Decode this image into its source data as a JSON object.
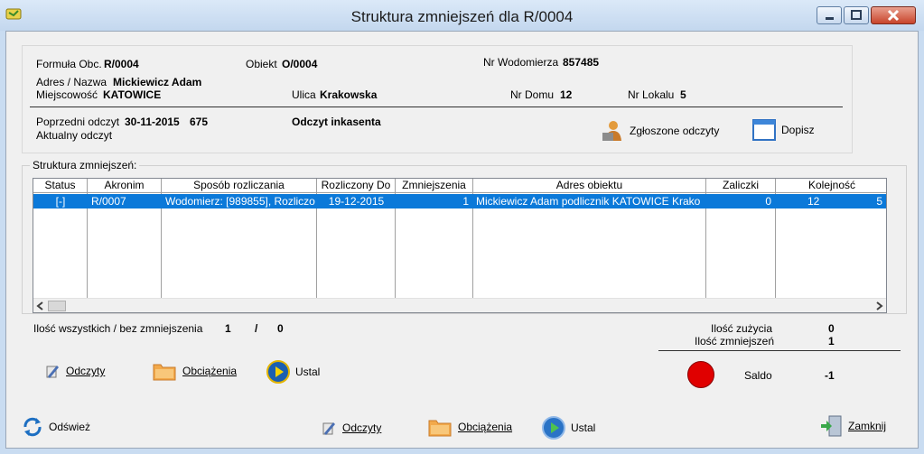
{
  "window": {
    "title": "Struktura zmniejszeń dla R/0004"
  },
  "info": {
    "formula_label": "Formuła Obc.",
    "formula_value": "R/0004",
    "obiekt_label": "Obiekt",
    "obiekt_value": "O/0004",
    "wodomierz_label": "Nr Wodomierza",
    "wodomierz_value": "857485",
    "adres_label": "Adres / Nazwa",
    "adres_value": "Mickiewicz Adam",
    "miejscowosc_label": "Miejscowość",
    "miejscowosc_value": "KATOWICE",
    "ulica_label": "Ulica",
    "ulica_value": "Krakowska",
    "domu_label": "Nr Domu",
    "domu_value": "12",
    "lokalu_label": "Nr Lokalu",
    "lokalu_value": "5",
    "poprzedni_label": "Poprzedni odczyt",
    "poprzedni_date": "30-11-2015",
    "poprzedni_value": "675",
    "aktualny_label": "Aktualny odczyt",
    "inkasenta": "Odczyt inkasenta",
    "zgloszone_label": "Zgłoszone odczyty",
    "dopisz_label": "Dopisz"
  },
  "group": {
    "title": "Struktura zmniejszeń:"
  },
  "table": {
    "headers": [
      "Status",
      "Akronim",
      "Sposób rozliczania",
      "Rozliczony Do",
      "Zmniejszenia",
      "Adres obiektu",
      "Zaliczki",
      "Kolejność"
    ],
    "rows": [
      [
        "[-]",
        "R/0007",
        "Wodomierz: [989855], Rozliczo",
        "19-12-2015",
        "1",
        "Mickiewicz Adam podlicznik KATOWICE Krako",
        "0",
        "12",
        "5"
      ]
    ]
  },
  "summary": {
    "ilosc_label": "Ilość wszystkich / bez zmniejszenia",
    "ilosc_all": "1",
    "sep": "/",
    "ilosc_bez": "0",
    "zuzycia_label": "Ilość zużycia",
    "zuzycia_value": "0",
    "zmniejszen_label": "Ilość zmniejszeń",
    "zmniejszen_value": "1",
    "saldo_label": "Saldo",
    "saldo_value": "-1",
    "status_color": "#e00000"
  },
  "inner_toolbar": {
    "odczyty": "Odczyty",
    "obciazenia": "Obciążenia",
    "ustal": "Ustal"
  },
  "bottom_toolbar": {
    "odswiez": "Odśwież",
    "odczyty": "Odczyty",
    "obciazenia": "Obciążenia",
    "ustal": "Ustal",
    "zamknij": "Zamknij"
  }
}
